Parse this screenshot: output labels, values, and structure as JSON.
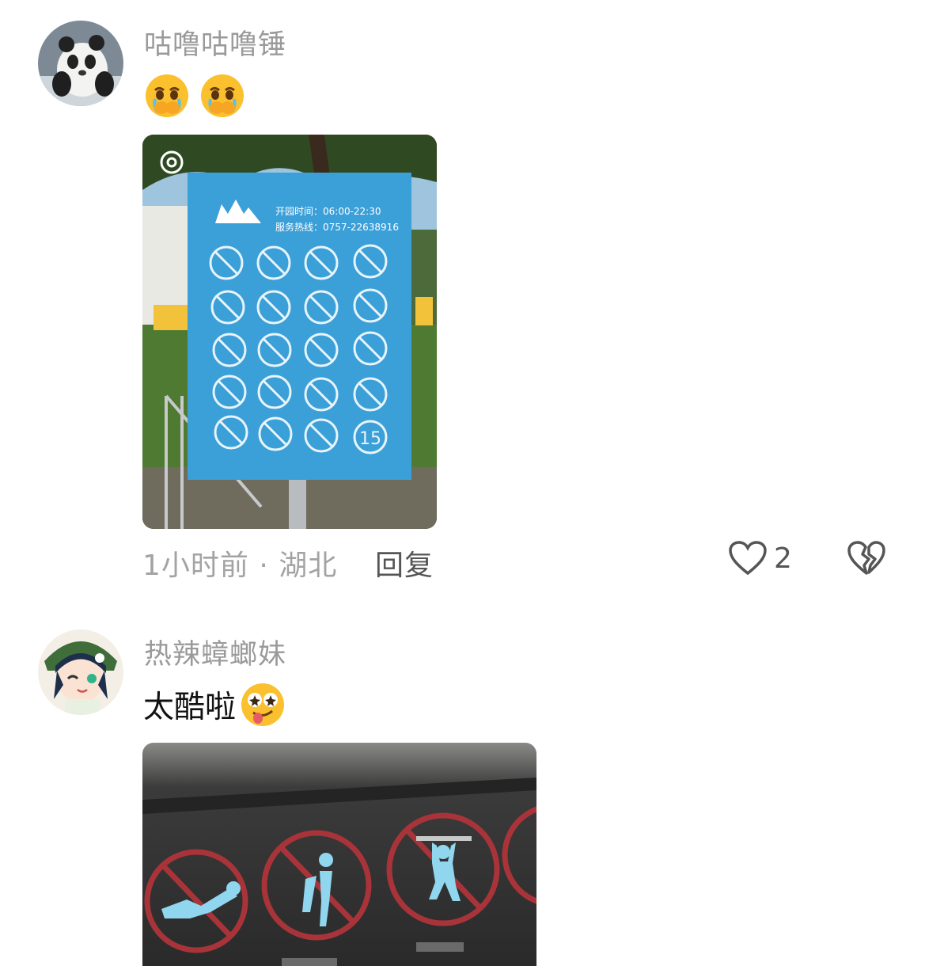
{
  "comments": [
    {
      "username": "咕噜咕噜锤",
      "emoji": [
        "crying-hands-emoji",
        "crying-hands-emoji"
      ],
      "image": {
        "sign": {
          "hours": "开园时间：06:00-22:30",
          "hotline": "服务热线：0757-22638916",
          "speed_limit": "15"
        }
      },
      "meta": "1小时前 · 湖北",
      "reply_label": "回复",
      "like_count": "2"
    },
    {
      "username": "热辣蟑螂妹",
      "text": "太酷啦",
      "emoji": [
        "starstruck-tongue-emoji"
      ]
    }
  ],
  "colors": {
    "username": "#9a9a9a",
    "meta": "#a3a3a3",
    "sign_blue": "#3b9fd8",
    "sign_red": "#a8343a"
  }
}
